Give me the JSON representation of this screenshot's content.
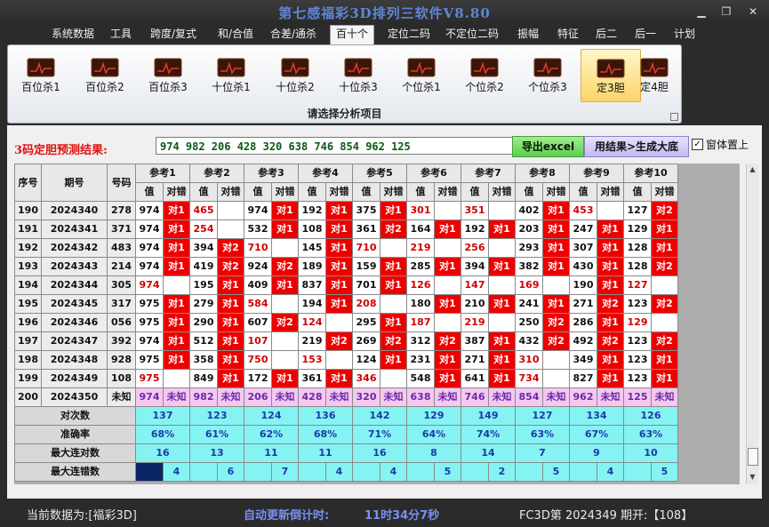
{
  "window": {
    "title": "第七感福彩3D排列三软件V8.80",
    "min": "▁",
    "max": "❐",
    "close": "✕"
  },
  "menu": [
    "系统数据",
    "工具",
    "跨度/复式",
    "和/合值",
    "合差/通杀",
    "百十个",
    "定位二码",
    "不定位二码",
    "振幅",
    "特征",
    "后二",
    "后一",
    "计划"
  ],
  "menu_active": 5,
  "tools": [
    "百位杀1",
    "百位杀2",
    "百位杀3",
    "十位杀1",
    "十位杀2",
    "十位杀3",
    "个位杀1",
    "个位杀2",
    "个位杀3",
    "定3胆",
    "定4胆"
  ],
  "tool_active": 9,
  "ribbon_caption": "请选择分析项目",
  "result": {
    "label": "3码定胆预测结果:",
    "value": "974 982 206 428 320 638 746 854 962 125",
    "export_btn": "导出excel",
    "apply_btn": "用结果>生成大底",
    "topmost_label": "窗体置上",
    "topmost_mark": "✓"
  },
  "table": {
    "headers": {
      "idx": "序号",
      "issue": "期号",
      "code": "号码",
      "value": "值",
      "check": "对错"
    },
    "refs": [
      "参考1",
      "参考2",
      "参考3",
      "参考4",
      "参考5",
      "参考6",
      "参考7",
      "参考8",
      "参考9",
      "参考10"
    ],
    "rows": [
      {
        "idx": "190",
        "issue": "2024340",
        "code": "278",
        "c": [
          [
            "974",
            false,
            "对1"
          ],
          [
            "465",
            true,
            ""
          ],
          [
            "974",
            false,
            "对1"
          ],
          [
            "192",
            false,
            "对1"
          ],
          [
            "375",
            false,
            "对1"
          ],
          [
            "301",
            true,
            ""
          ],
          [
            "351",
            true,
            ""
          ],
          [
            "402",
            false,
            "对1"
          ],
          [
            "453",
            true,
            ""
          ],
          [
            "127",
            false,
            "对2"
          ]
        ]
      },
      {
        "idx": "191",
        "issue": "2024341",
        "code": "371",
        "c": [
          [
            "974",
            false,
            "对1"
          ],
          [
            "254",
            true,
            ""
          ],
          [
            "532",
            false,
            "对1"
          ],
          [
            "108",
            false,
            "对1"
          ],
          [
            "361",
            false,
            "对2"
          ],
          [
            "164",
            false,
            "对1"
          ],
          [
            "192",
            false,
            "对1"
          ],
          [
            "203",
            false,
            "对1"
          ],
          [
            "247",
            false,
            "对1"
          ],
          [
            "129",
            false,
            "对1"
          ]
        ]
      },
      {
        "idx": "192",
        "issue": "2024342",
        "code": "483",
        "c": [
          [
            "974",
            false,
            "对1"
          ],
          [
            "394",
            false,
            "对2"
          ],
          [
            "710",
            true,
            ""
          ],
          [
            "145",
            false,
            "对1"
          ],
          [
            "710",
            true,
            ""
          ],
          [
            "219",
            true,
            ""
          ],
          [
            "256",
            true,
            ""
          ],
          [
            "293",
            false,
            "对1"
          ],
          [
            "307",
            false,
            "对1"
          ],
          [
            "128",
            false,
            "对1"
          ]
        ]
      },
      {
        "idx": "193",
        "issue": "2024343",
        "code": "214",
        "c": [
          [
            "974",
            false,
            "对1"
          ],
          [
            "419",
            false,
            "对2"
          ],
          [
            "924",
            false,
            "对2"
          ],
          [
            "189",
            false,
            "对1"
          ],
          [
            "159",
            false,
            "对1"
          ],
          [
            "285",
            false,
            "对1"
          ],
          [
            "394",
            false,
            "对1"
          ],
          [
            "382",
            false,
            "对1"
          ],
          [
            "430",
            false,
            "对1"
          ],
          [
            "128",
            false,
            "对2"
          ]
        ]
      },
      {
        "idx": "194",
        "issue": "2024344",
        "code": "305",
        "c": [
          [
            "974",
            true,
            ""
          ],
          [
            "195",
            false,
            "对1"
          ],
          [
            "409",
            false,
            "对1"
          ],
          [
            "837",
            false,
            "对1"
          ],
          [
            "701",
            false,
            "对1"
          ],
          [
            "126",
            true,
            ""
          ],
          [
            "147",
            true,
            ""
          ],
          [
            "169",
            true,
            ""
          ],
          [
            "190",
            false,
            "对1"
          ],
          [
            "127",
            true,
            ""
          ]
        ]
      },
      {
        "idx": "195",
        "issue": "2024345",
        "code": "317",
        "c": [
          [
            "975",
            false,
            "对1"
          ],
          [
            "279",
            false,
            "对1"
          ],
          [
            "584",
            true,
            ""
          ],
          [
            "194",
            false,
            "对1"
          ],
          [
            "208",
            true,
            ""
          ],
          [
            "180",
            false,
            "对1"
          ],
          [
            "210",
            false,
            "对1"
          ],
          [
            "241",
            false,
            "对1"
          ],
          [
            "271",
            false,
            "对2"
          ],
          [
            "123",
            false,
            "对2"
          ]
        ]
      },
      {
        "idx": "196",
        "issue": "2024346",
        "code": "056",
        "c": [
          [
            "975",
            false,
            "对1"
          ],
          [
            "290",
            false,
            "对1"
          ],
          [
            "607",
            false,
            "对2"
          ],
          [
            "124",
            true,
            ""
          ],
          [
            "295",
            false,
            "对1"
          ],
          [
            "187",
            true,
            ""
          ],
          [
            "219",
            true,
            ""
          ],
          [
            "250",
            false,
            "对2"
          ],
          [
            "286",
            false,
            "对1"
          ],
          [
            "129",
            true,
            ""
          ]
        ]
      },
      {
        "idx": "197",
        "issue": "2024347",
        "code": "392",
        "c": [
          [
            "974",
            false,
            "对1"
          ],
          [
            "512",
            false,
            "对1"
          ],
          [
            "107",
            true,
            ""
          ],
          [
            "219",
            false,
            "对2"
          ],
          [
            "269",
            false,
            "对2"
          ],
          [
            "312",
            false,
            "对2"
          ],
          [
            "387",
            false,
            "对1"
          ],
          [
            "432",
            false,
            "对2"
          ],
          [
            "492",
            false,
            "对2"
          ],
          [
            "123",
            false,
            "对2"
          ]
        ]
      },
      {
        "idx": "198",
        "issue": "2024348",
        "code": "928",
        "c": [
          [
            "975",
            false,
            "对1"
          ],
          [
            "358",
            false,
            "对1"
          ],
          [
            "750",
            true,
            ""
          ],
          [
            "153",
            true,
            ""
          ],
          [
            "124",
            false,
            "对1"
          ],
          [
            "231",
            false,
            "对1"
          ],
          [
            "271",
            false,
            "对1"
          ],
          [
            "310",
            true,
            ""
          ],
          [
            "349",
            false,
            "对1"
          ],
          [
            "123",
            false,
            "对1"
          ]
        ]
      },
      {
        "idx": "199",
        "issue": "2024349",
        "code": "108",
        "c": [
          [
            "975",
            true,
            ""
          ],
          [
            "849",
            false,
            "对1"
          ],
          [
            "172",
            false,
            "对1"
          ],
          [
            "361",
            false,
            "对1"
          ],
          [
            "346",
            true,
            ""
          ],
          [
            "548",
            false,
            "对1"
          ],
          [
            "641",
            false,
            "对1"
          ],
          [
            "734",
            true,
            ""
          ],
          [
            "827",
            false,
            "对1"
          ],
          [
            "123",
            false,
            "对1"
          ]
        ]
      }
    ],
    "next_row": {
      "idx": "200",
      "issue": "2024350",
      "code": "未知",
      "unknown": "未知",
      "values": [
        "974",
        "982",
        "206",
        "428",
        "320",
        "638",
        "746",
        "854",
        "962",
        "125"
      ]
    },
    "stats": [
      {
        "label": "对次数",
        "values": [
          "137",
          "123",
          "124",
          "136",
          "142",
          "129",
          "149",
          "127",
          "134",
          "126"
        ]
      },
      {
        "label": "准确率",
        "values": [
          "68%",
          "61%",
          "62%",
          "68%",
          "71%",
          "64%",
          "74%",
          "63%",
          "67%",
          "63%"
        ]
      },
      {
        "label": "最大连对数",
        "values": [
          "16",
          "13",
          "11",
          "11",
          "16",
          "8",
          "14",
          "7",
          "9",
          "10"
        ]
      },
      {
        "label": "最大连错数",
        "values": [
          "4",
          "6",
          "7",
          "4",
          "4",
          "5",
          "2",
          "5",
          "4",
          "5"
        ]
      }
    ]
  },
  "scroll": {
    "up": "▲",
    "down": "▼"
  },
  "status": {
    "current": "当前数据为:[福彩3D]",
    "countdown_label": "自动更新倒计时:",
    "countdown": "11时34分7秒",
    "issue_info": "FC3D第 2024349 期开:【108】"
  },
  "colors": {
    "hit": "#ee0000",
    "stat": "#86f3f3",
    "next": "#f5c8f0",
    "title": "#5f86d8",
    "countdown": "#7b8ff0"
  }
}
